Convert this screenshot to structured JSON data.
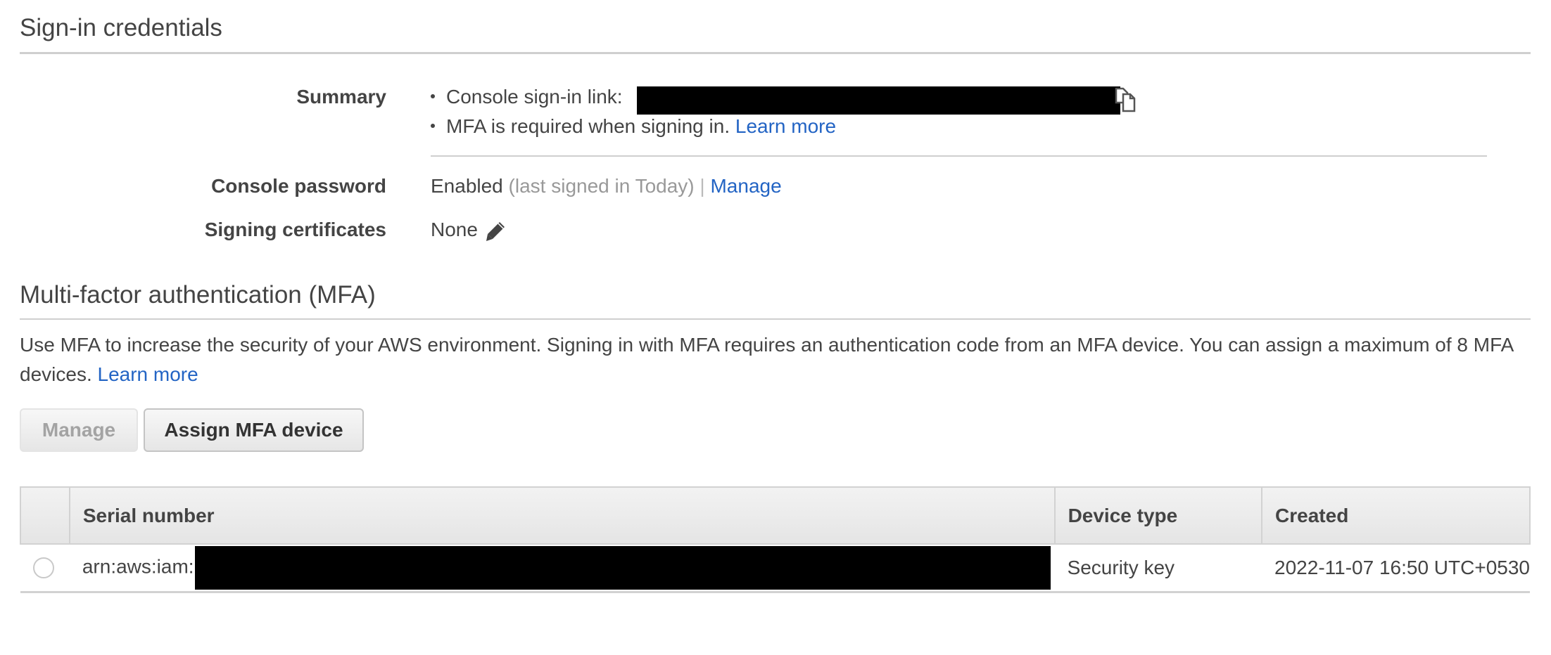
{
  "signin": {
    "title": "Sign-in credentials",
    "summary_label": "Summary",
    "console_link_label": "Console sign-in link:",
    "console_link_value": "[redacted]",
    "mfa_required_text": "MFA is required when signing in.",
    "mfa_learn_more": "Learn more",
    "console_password_label": "Console password",
    "console_password_status": "Enabled",
    "console_password_last": "(last signed in Today)",
    "separator": "|",
    "console_password_manage": "Manage",
    "signing_cert_label": "Signing certificates",
    "signing_cert_value": "None",
    "icons": {
      "copy": "copy-icon",
      "edit": "pencil-icon"
    }
  },
  "mfa": {
    "title": "Multi-factor authentication (MFA)",
    "description": "Use MFA to increase the security of your AWS environment. Signing in with MFA requires an authentication code from an MFA device. You can assign a maximum of 8 MFA devices.",
    "learn_more": "Learn more",
    "manage_button": "Manage",
    "assign_button": "Assign MFA device",
    "table": {
      "columns": [
        "",
        "Serial number",
        "Device type",
        "Created"
      ],
      "rows": [
        {
          "selected": false,
          "serial_prefix": "arn:aws:iam:",
          "serial_redacted": "[redacted]",
          "device_type": "Security key",
          "created": "2022-11-07 16:50 UTC+0530"
        }
      ]
    }
  },
  "colors": {
    "link": "#2364c4",
    "text": "#444444",
    "muted": "#999999",
    "divider": "#cfcfcf"
  }
}
